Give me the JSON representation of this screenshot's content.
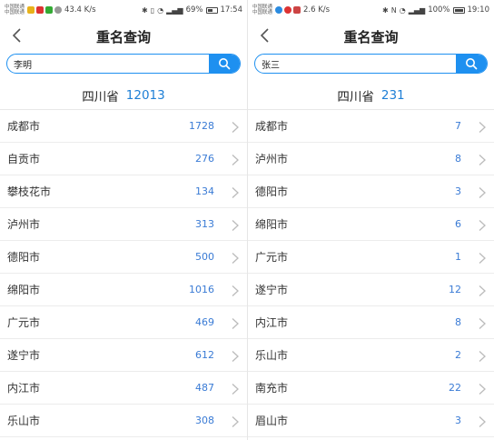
{
  "left": {
    "status": {
      "carrier1": "中国联通",
      "carrier2": "中国联通",
      "speed": "43.4 K/s",
      "battery": "69%",
      "battery_level": 0.69,
      "time": "17:54"
    },
    "title": "重名查询",
    "search": {
      "value": "李明",
      "placeholder": ""
    },
    "province": {
      "name": "四川省",
      "count": "12013"
    },
    "cities": [
      {
        "name": "成都市",
        "count": "1728"
      },
      {
        "name": "自贡市",
        "count": "276"
      },
      {
        "name": "攀枝花市",
        "count": "134"
      },
      {
        "name": "泸州市",
        "count": "313"
      },
      {
        "name": "德阳市",
        "count": "500"
      },
      {
        "name": "绵阳市",
        "count": "1016"
      },
      {
        "name": "广元市",
        "count": "469"
      },
      {
        "name": "遂宁市",
        "count": "612"
      },
      {
        "name": "内江市",
        "count": "487"
      },
      {
        "name": "乐山市",
        "count": "308"
      }
    ]
  },
  "right": {
    "status": {
      "carrier1": "中国联通",
      "carrier2": "中国联通",
      "speed": "2.6 K/s",
      "battery": "100%",
      "battery_level": 1.0,
      "time": "19:10"
    },
    "title": "重名查询",
    "search": {
      "value": "张三",
      "placeholder": ""
    },
    "province": {
      "name": "四川省",
      "count": "231"
    },
    "cities": [
      {
        "name": "成都市",
        "count": "7"
      },
      {
        "name": "泸州市",
        "count": "8"
      },
      {
        "name": "德阳市",
        "count": "3"
      },
      {
        "name": "绵阳市",
        "count": "6"
      },
      {
        "name": "广元市",
        "count": "1"
      },
      {
        "name": "遂宁市",
        "count": "12"
      },
      {
        "name": "内江市",
        "count": "8"
      },
      {
        "name": "乐山市",
        "count": "2"
      },
      {
        "name": "南充市",
        "count": "22"
      },
      {
        "name": "眉山市",
        "count": "3"
      }
    ]
  },
  "colors": {
    "accent": "#1e90f0",
    "count_text": "#3a7bd5",
    "province_count": "#1e7fd6"
  }
}
